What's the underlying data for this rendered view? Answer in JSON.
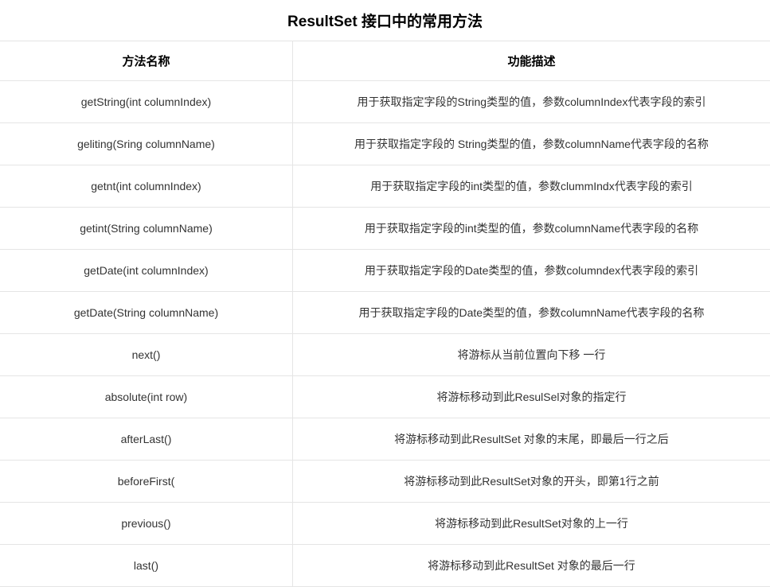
{
  "table": {
    "title": "ResultSet 接口中的常用方法",
    "headers": {
      "method": "方法名称",
      "description": "功能描述"
    },
    "rows": [
      {
        "method": "getString(int columnIndex)",
        "description": "用于获取指定字段的String类型的值，参数columnIndex代表字段的索引"
      },
      {
        "method": "geliting(Sring columnName)",
        "description": "用于获取指定字段的 String类型的值，参数columnName代表字段的名称"
      },
      {
        "method": "getnt(int columnIndex)",
        "description": "用于获取指定字段的int类型的值，参数clummIndx代表字段的索引"
      },
      {
        "method": "getint(String columnName)",
        "description": "用于获取指定字段的int类型的值，参数columnName代表字段的名称"
      },
      {
        "method": "getDate(int columnIndex)",
        "description": "用于获取指定字段的Date类型的值，参数columndex代表字段的索引"
      },
      {
        "method": "getDate(String columnName)",
        "description": "用于获取指定字段的Date类型的值，参数columnName代表字段的名称"
      },
      {
        "method": "next()",
        "description": "将游标从当前位置向下移 一行"
      },
      {
        "method": "absolute(int row)",
        "description": "将游标移动到此ResulSel对象的指定行"
      },
      {
        "method": "afterLast()",
        "description": "将游标移动到此ResultSet 对象的末尾，即最后一行之后"
      },
      {
        "method": "beforeFirst(",
        "description": "将游标移动到此ResultSet对象的开头，即第1行之前"
      },
      {
        "method": "previous()",
        "description": "将游标移动到此ResultSet对象的上一行"
      },
      {
        "method": "last()",
        "description": "将游标移动到此ResultSet 对象的最后一行"
      }
    ]
  }
}
